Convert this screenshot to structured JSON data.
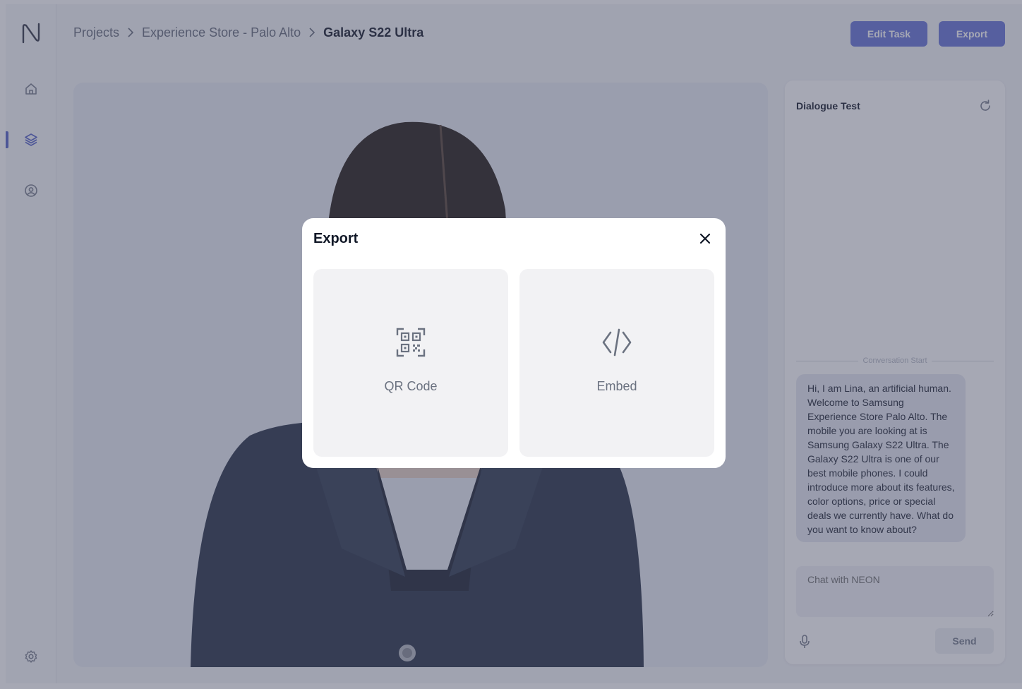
{
  "breadcrumb": {
    "items": [
      "Projects",
      "Experience Store - Palo Alto"
    ],
    "current": "Galaxy S22 Ultra"
  },
  "header": {
    "edit_task_label": "Edit Task",
    "export_label": "Export"
  },
  "sidebar": {
    "items": [
      {
        "icon": "home-icon",
        "active": false
      },
      {
        "icon": "layers-icon",
        "active": true
      },
      {
        "icon": "user-circle-icon",
        "active": false
      }
    ],
    "footer_icon": "settings-icon"
  },
  "dialogue": {
    "title": "Dialogue Test",
    "conversation_start": "Conversation Start",
    "messages": [
      {
        "text": "Hi, I am Lina, an artificial human. Welcome to Samsung Experience Store Palo Alto. The mobile you are looking at is Samsung Galaxy S22 Ultra. The Galaxy S22 Ultra is one of our best mobile phones. I could introduce more about its features, color options, price or special deals we currently have. What do you want to know about?"
      }
    ],
    "input_placeholder": "Chat with NEON",
    "send_label": "Send"
  },
  "modal": {
    "title": "Export",
    "options": [
      {
        "label": "QR Code",
        "icon": "qr-code-icon"
      },
      {
        "label": "Embed",
        "icon": "code-embed-icon"
      }
    ]
  },
  "colors": {
    "accent": "#6b78d8",
    "overlay": "#3c425c",
    "option_bg": "#f2f2f4"
  }
}
